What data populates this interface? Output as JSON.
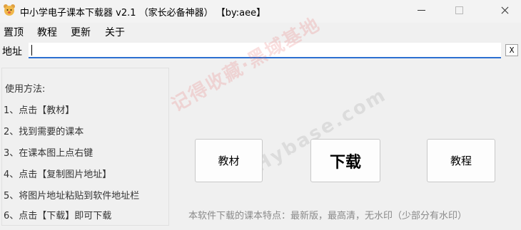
{
  "window": {
    "title": "中小学电子课本下载器  v2.1  （家长必备神器）  【by:aee】"
  },
  "menu": {
    "items": [
      "置顶",
      "教程",
      "更新",
      "关于"
    ]
  },
  "address": {
    "label": "地址",
    "value": "",
    "clear_label": "X"
  },
  "instructions": {
    "title": "使用方法:",
    "steps": [
      "1、点击【教材】",
      "2、找到需要的课本",
      "3、在课本图上点右键",
      "4、点击【复制图片地址】",
      "5、将图片地址粘贴到软件地址栏",
      "6、点击【下载】即可下载"
    ]
  },
  "buttons": {
    "textbook": "教材",
    "download": "下载",
    "tutorial": "教程"
  },
  "footer_note": "本软件下载的课本特点：最新版，最高清，无水印（少部分有水印）",
  "watermark": {
    "text_cn": "记得收藏·黑域基地",
    "text_en": "Hybase.com"
  },
  "icons": {
    "app": "bear-face-icon",
    "minimize": "minimize-icon",
    "maximize": "maximize-icon",
    "close": "close-icon"
  },
  "colors": {
    "input_underline": "#2b6fd1",
    "watermark": "#e66e6e"
  }
}
